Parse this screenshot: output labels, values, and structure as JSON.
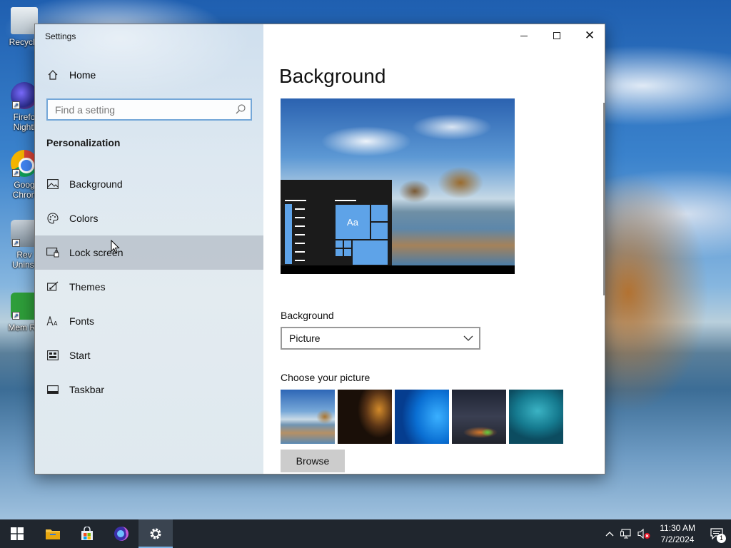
{
  "desktop": {
    "icons": [
      {
        "label": "Recycle",
        "icon": "recycle-bin-icon"
      },
      {
        "label": "Firefo Nightl",
        "icon": "firefox-nightly-icon"
      },
      {
        "label": "Goog Chron",
        "icon": "google-chrome-icon"
      },
      {
        "label": "Rev Uninst",
        "icon": "revo-uninstaller-icon"
      },
      {
        "label": "Mem Re",
        "icon": "mem-reduct-icon"
      }
    ]
  },
  "window": {
    "title": "Settings",
    "controls": {
      "minimize": "minimize-icon",
      "maximize": "maximize-icon",
      "close": "close-icon"
    }
  },
  "sidebar": {
    "home_label": "Home",
    "search_placeholder": "Find a setting",
    "section_title": "Personalization",
    "items": [
      {
        "label": "Background",
        "icon": "picture-icon"
      },
      {
        "label": "Colors",
        "icon": "palette-icon"
      },
      {
        "label": "Lock screen",
        "icon": "lock-screen-icon",
        "hovered": true
      },
      {
        "label": "Themes",
        "icon": "themes-icon"
      },
      {
        "label": "Fonts",
        "icon": "fonts-icon"
      },
      {
        "label": "Start",
        "icon": "start-icon"
      },
      {
        "label": "Taskbar",
        "icon": "taskbar-icon"
      }
    ]
  },
  "content": {
    "title": "Background",
    "preview_tile_text": "Aa",
    "background_label": "Background",
    "background_value": "Picture",
    "choose_label": "Choose your picture",
    "browse_label": "Browse"
  },
  "taskbar": {
    "apps": [
      "start-icon",
      "file-explorer-icon",
      "microsoft-store-icon",
      "firefox-nightly-icon",
      "settings-gear-icon"
    ],
    "time": "11:30 AM",
    "date": "7/2/2024",
    "notification_count": "1"
  },
  "colors": {
    "accent": "#5ea3e8",
    "taskbar": "#20262e",
    "search_border": "#74a7d8"
  }
}
